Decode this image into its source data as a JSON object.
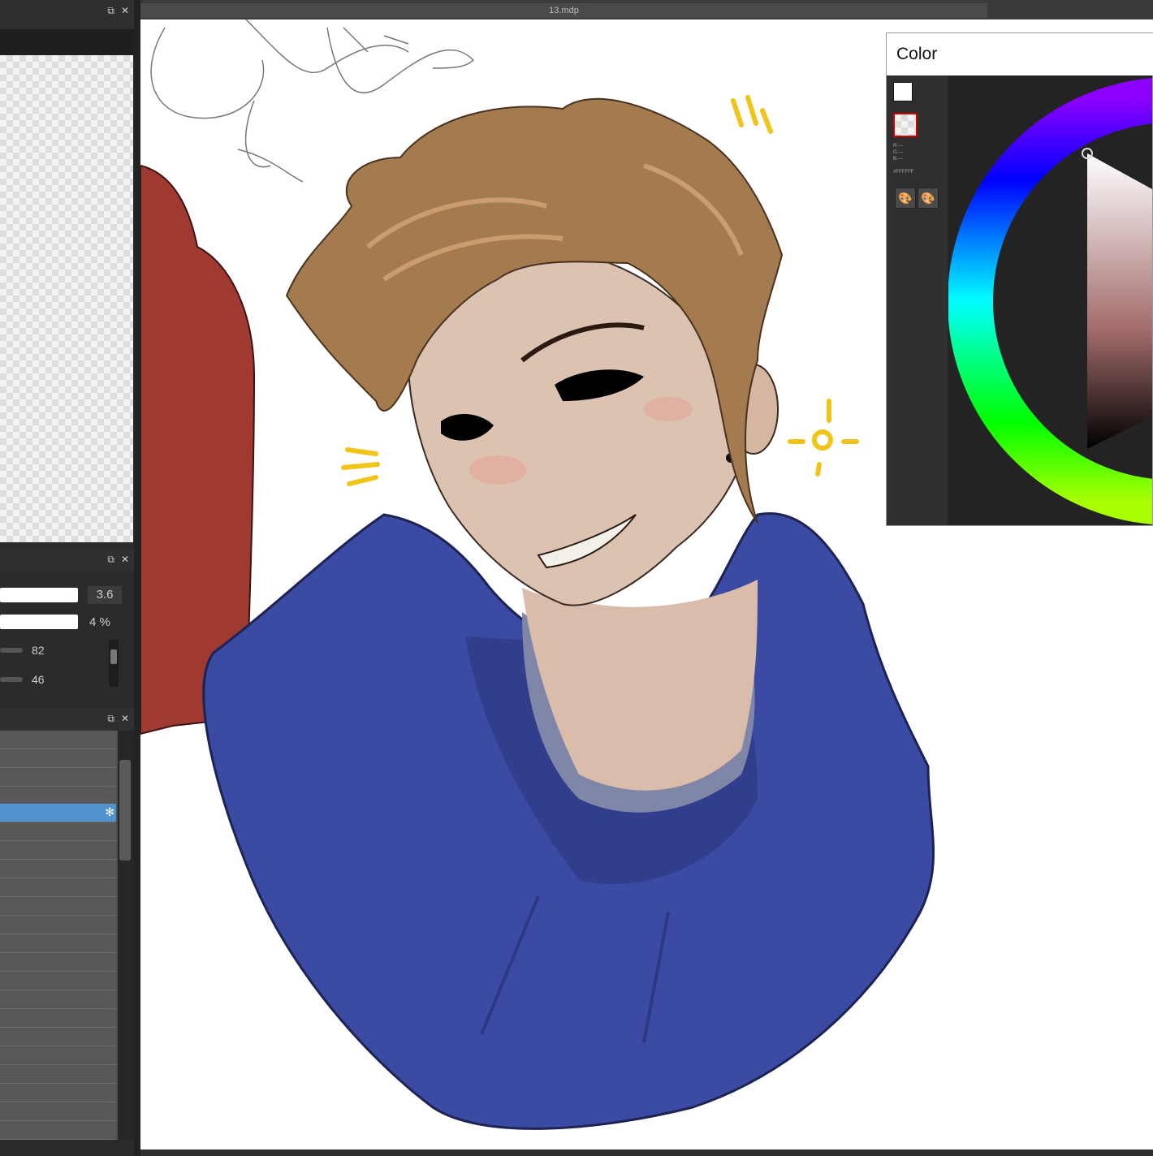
{
  "document": {
    "tab_title": "13.mdp"
  },
  "icons": {
    "float": "float-window-icon",
    "close": "close-icon",
    "gear": "gear-icon",
    "palette": "palette-icon",
    "palette_edit": "palette-edit-icon"
  },
  "brush_panel": {
    "size_value": "3.6",
    "opacity_value": "4 %",
    "param1_value": "82",
    "param2_value": "46"
  },
  "color_window": {
    "title": "Color",
    "rgb_r": "R:---",
    "rgb_g": "G:---",
    "rgb_b": "B:---",
    "hex": "#FFFFFF"
  },
  "colors": {
    "panel_bg": "#2f2f2f",
    "selected_row": "#4f94cf",
    "row_bg": "#585858",
    "hoodie": "#3b4aa3",
    "hair": "#a47a4f",
    "skin": "#dcc3b1",
    "red_figure": "#a03a31",
    "doodle_yellow": "#f0c419"
  }
}
